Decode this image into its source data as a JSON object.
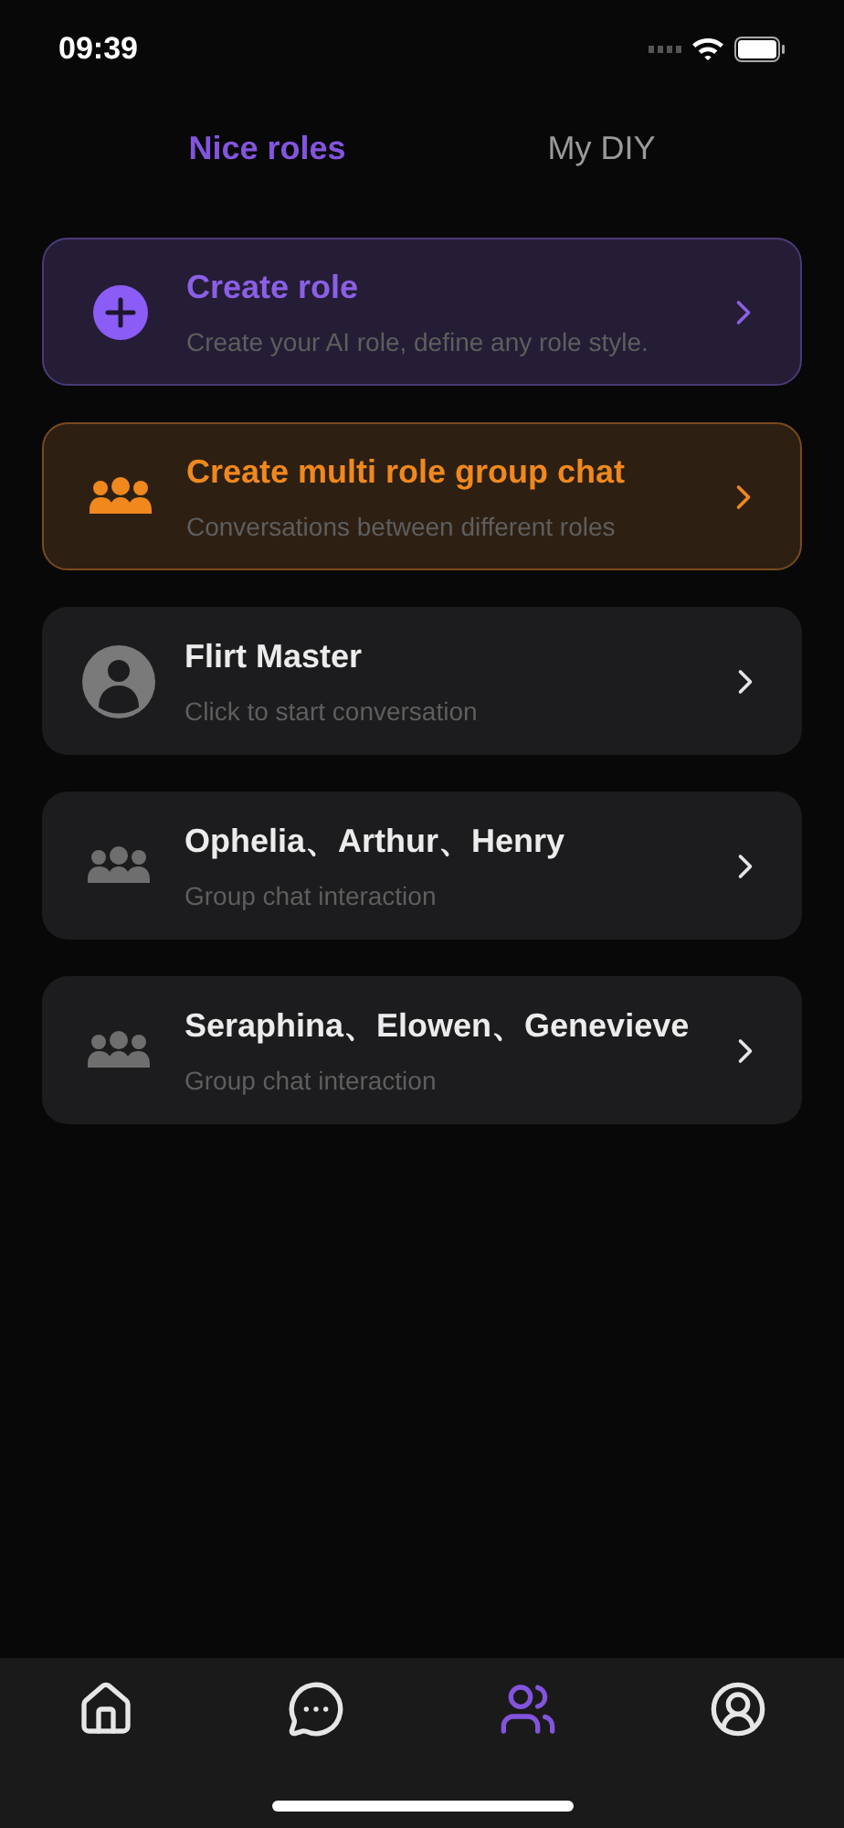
{
  "status_bar": {
    "time": "09:39"
  },
  "tabs": [
    {
      "label": "Nice roles",
      "selected": true
    },
    {
      "label": "My DIY",
      "selected": false
    }
  ],
  "cards": [
    {
      "kind": "create",
      "title": "Create role",
      "subtitle": "Create your AI role, define any role style."
    },
    {
      "kind": "group_create",
      "title": "Create multi role group chat",
      "subtitle": "Conversations between different roles"
    },
    {
      "kind": "person",
      "title": "Flirt Master",
      "subtitle": "Click to start conversation"
    },
    {
      "kind": "group",
      "title": "Ophelia、Arthur、Henry",
      "subtitle": "Group chat interaction"
    },
    {
      "kind": "group",
      "title": "Seraphina、Elowen、Genevieve",
      "subtitle": "Group chat interaction"
    }
  ],
  "nav": [
    {
      "kind": "home",
      "selected": false
    },
    {
      "kind": "chat",
      "selected": false
    },
    {
      "kind": "roles",
      "selected": true
    },
    {
      "kind": "profile",
      "selected": false
    }
  ]
}
